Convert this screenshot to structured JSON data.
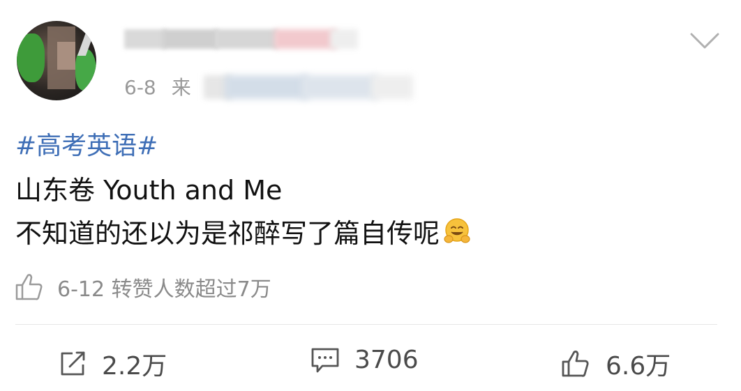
{
  "post": {
    "date": "6-8",
    "source_prefix": "来",
    "hashtag": "#高考英语#",
    "line1": "山东卷 Youth and Me",
    "line2": "不知道的还以为是祁醉写了篇自传呢"
  },
  "repost_info": {
    "text": "6-12 转赞人数超过7万"
  },
  "actions": {
    "repost_count": "2.2万",
    "comment_count": "3706",
    "like_count": "6.6万"
  },
  "colors": {
    "hashtag": "#3e6eb6",
    "meta": "#999999",
    "action": "#4a4a4a"
  },
  "icons": {
    "more": "chevron-down-icon",
    "repost_info": "thumbs-up-icon",
    "repost": "repost-icon",
    "comment": "comment-icon",
    "like": "thumbs-up-icon",
    "emoji": "hugging-face-emoji"
  }
}
